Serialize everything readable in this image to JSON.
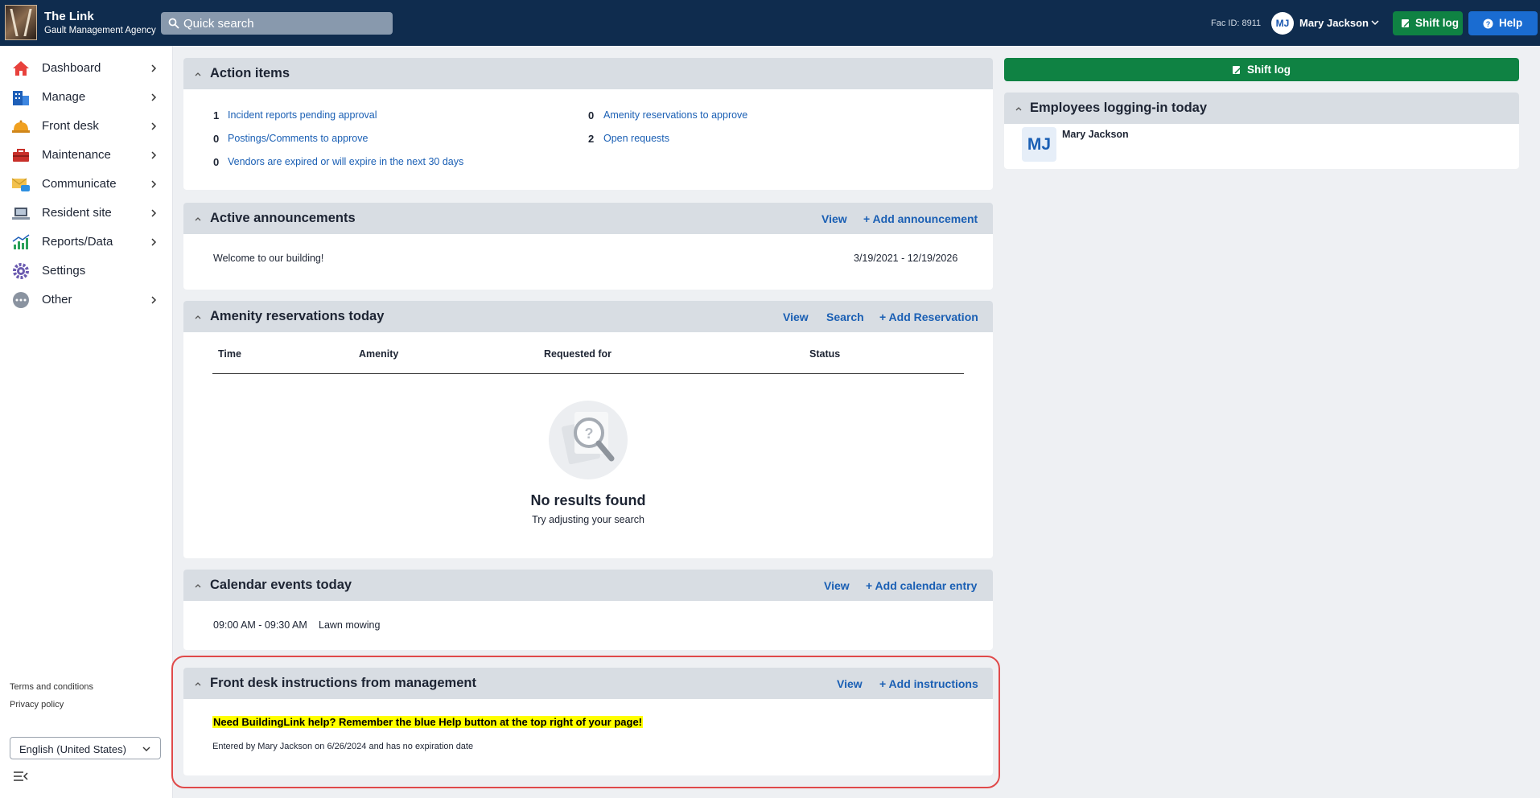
{
  "app": {
    "title": "The Link",
    "subtitle": "Gault Management Agency"
  },
  "search": {
    "placeholder": "Quick search"
  },
  "header": {
    "fac_id": "Fac ID: 8911",
    "user_initials": "MJ",
    "user_name": "Mary Jackson",
    "shift_log_label": "Shift log",
    "help_label": "Help"
  },
  "sidebar": {
    "items": [
      {
        "label": "Dashboard",
        "icon": "house-icon"
      },
      {
        "label": "Manage",
        "icon": "building-icon"
      },
      {
        "label": "Front desk",
        "icon": "bell-icon"
      },
      {
        "label": "Maintenance",
        "icon": "toolbox-icon"
      },
      {
        "label": "Communicate",
        "icon": "envelope-icon"
      },
      {
        "label": "Resident site",
        "icon": "laptop-icon"
      },
      {
        "label": "Reports/Data",
        "icon": "chart-icon"
      },
      {
        "label": "Settings",
        "icon": "gear-icon"
      },
      {
        "label": "Other",
        "icon": "more-icon"
      }
    ],
    "terms": "Terms and conditions",
    "privacy": "Privacy policy",
    "language": "English (United States)"
  },
  "action_items": {
    "title": "Action items",
    "left": [
      {
        "count": "1",
        "label": "Incident reports pending approval"
      },
      {
        "count": "0",
        "label": "Postings/Comments to approve"
      },
      {
        "count": "0",
        "label": "Vendors are expired or will expire in the next 30 days"
      }
    ],
    "right": [
      {
        "count": "0",
        "label": "Amenity reservations to approve"
      },
      {
        "count": "2",
        "label": "Open requests"
      }
    ]
  },
  "announcements": {
    "title": "Active announcements",
    "view": "View",
    "add": "+ Add announcement",
    "text": "Welcome to our building!",
    "dates": "3/19/2021 - 12/19/2026"
  },
  "amenity": {
    "title": "Amenity reservations today",
    "view": "View",
    "search": "Search",
    "add": "+ Add Reservation",
    "columns": [
      "Time",
      "Amenity",
      "Requested for",
      "Status"
    ],
    "empty_title": "No results found",
    "empty_sub": "Try adjusting your search"
  },
  "calendar": {
    "title": "Calendar events today",
    "view": "View",
    "add": "+ Add calendar entry",
    "time": "09:00 AM - 09:30 AM",
    "event": "Lawn mowing"
  },
  "instructions": {
    "title": "Front desk instructions from management",
    "view": "View",
    "add": "+ Add instructions",
    "message": "Need BuildingLink help? Remember the blue Help button at the top right of your page!",
    "entered": "Entered by Mary Jackson on 6/26/2024 and has no expiration date"
  },
  "right_panel": {
    "shift_log_label": "Shift log",
    "employees_title": "Employees logging-in today",
    "employee_initials": "MJ",
    "employee_name": "Mary Jackson"
  },
  "colors": {
    "topbar": "#0f2c4e",
    "green": "#0f8243",
    "blue": "#1a6cd1",
    "link": "#1a5fb4",
    "highlight": "#ffff00"
  }
}
